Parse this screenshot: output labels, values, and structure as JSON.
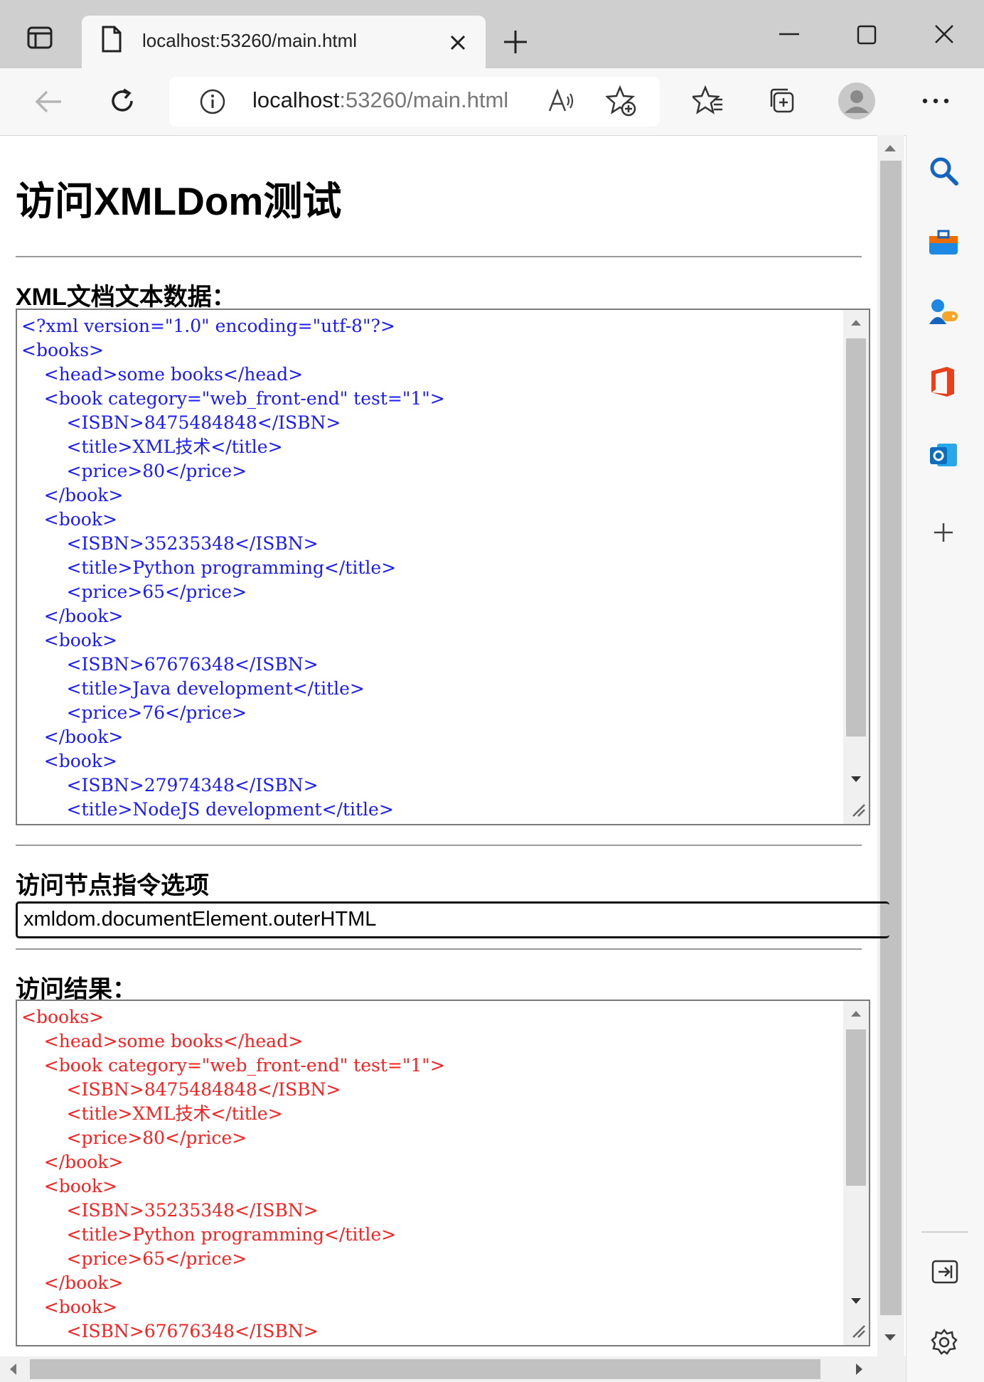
{
  "browser": {
    "tab_title": "localhost:53260/main.html",
    "address_host": "localhost",
    "address_rest": ":53260/main.html"
  },
  "page": {
    "title": "访问XMLDom测试",
    "xml_section_label": "XML文档文本数据：",
    "xml_text": "<?xml version=\"1.0\" encoding=\"utf-8\"?>\n<books>\n\t<head>some books</head>\n\t<book category=\"web_front-end\" test=\"1\">\n\t\t<ISBN>8475484848</ISBN>\n\t\t<title>XML技术</title>\n\t\t<price>80</price>\n\t</book>\n\t<book>\n\t\t<ISBN>35235348</ISBN>\n\t\t<title>Python programming</title>\n\t\t<price>65</price>\n\t</book>\n\t<book>\n\t\t<ISBN>67676348</ISBN>\n\t\t<title>Java development</title>\n\t\t<price>76</price>\n\t</book>\n\t<book>\n\t\t<ISBN>27974348</ISBN>\n\t\t<title>NodeJS development</title>",
    "command_label": "访问节点指令选项",
    "command_value": "xmldom.documentElement.outerHTML",
    "result_label": "访问结果：",
    "result_text": "<books>\n\t<head>some books</head>\n\t<book category=\"web_front-end\" test=\"1\">\n\t\t<ISBN>8475484848</ISBN>\n\t\t<title>XML技术</title>\n\t\t<price>80</price>\n\t</book>\n\t<book>\n\t\t<ISBN>35235348</ISBN>\n\t\t<title>Python programming</title>\n\t\t<price>65</price>\n\t</book>\n\t<book>\n\t\t<ISBN>67676348</ISBN>"
  },
  "colors": {
    "xml_text": "#1a1aff",
    "result_text": "#ff1e1e",
    "search_icon": "#1565c0",
    "office_icon": "#e8401c",
    "outlook_icon": "#0f6cbd"
  }
}
